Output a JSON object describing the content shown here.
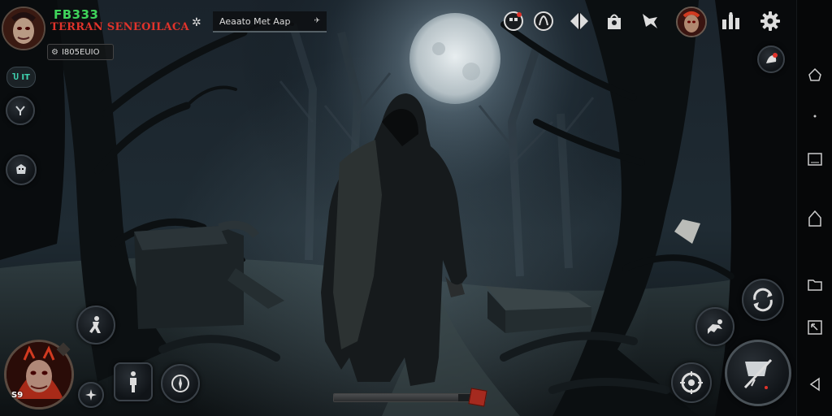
{
  "player": {
    "id": "FB333",
    "name": "TERRAN SENEOILACA",
    "tag": "I805EUIO",
    "level_badge": "Ⴎ IT",
    "avatar_badge": "S9"
  },
  "quest": {
    "label": "Aeaato Met Aap"
  },
  "health": {
    "fraction": 0.82
  },
  "colors": {
    "id_green": "#3fd35a",
    "name_red": "#e0332b",
    "accent_orange": "#ff6a1a",
    "health_red": "#a52a1f"
  },
  "icons": {
    "top_bar": [
      "mask-icon",
      "claw-icon",
      "diamond-icon",
      "bag-icon",
      "wolf-icon",
      "character-avatar",
      "stats-icon",
      "gear-icon",
      "star-burst-icon"
    ],
    "left_column": [
      "level-badge",
      "wrench-icon",
      "monster-icon"
    ],
    "bottom": [
      "dodge-icon",
      "sparkle-icon",
      "figure-icon",
      "compass-icon",
      "target-icon",
      "crawl-icon",
      "spin-icon",
      "weapon-icon"
    ],
    "nav": [
      "home-icon",
      "dot-icon",
      "window-icon",
      "home-outline-icon",
      "folder-icon",
      "expand-icon",
      "back-icon"
    ]
  }
}
